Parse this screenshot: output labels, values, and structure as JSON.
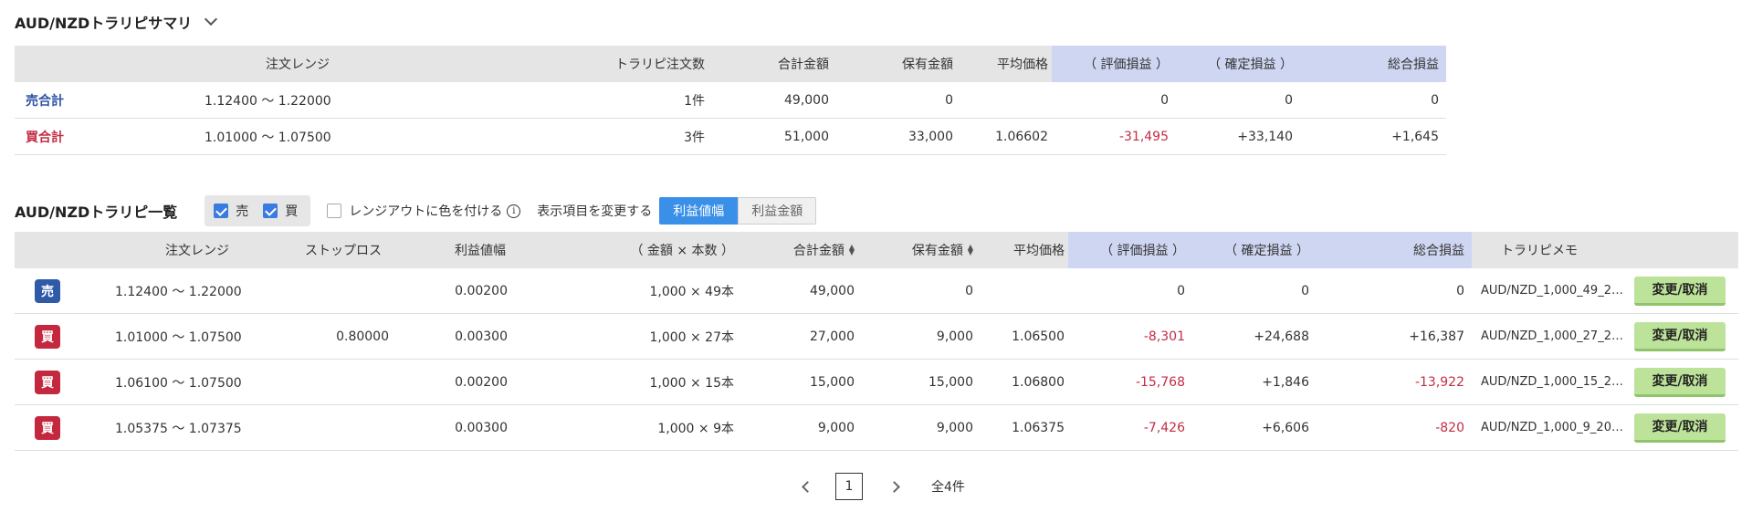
{
  "summary": {
    "title": "AUD/NZDトラリピサマリ",
    "headers": {
      "range": "注文レンジ",
      "orders": "トラリピ注文数",
      "total": "合計金額",
      "holding": "保有金額",
      "avg": "平均価格",
      "unrealized": "（ 評価損益 ）",
      "realized": "（ 確定損益 ）",
      "net": "総合損益"
    },
    "rows": [
      {
        "label": "売合計",
        "range": "1.12400 〜 1.22000",
        "orders": "1件",
        "total": "49,000",
        "holding": "0",
        "avg": "",
        "unrealized": "0",
        "realized": "0",
        "net": "0"
      },
      {
        "label": "買合計",
        "range": "1.01000 〜 1.07500",
        "orders": "3件",
        "total": "51,000",
        "holding": "33,000",
        "avg": "1.06602",
        "unrealized": "-31,495",
        "realized": "+33,140",
        "net": "+1,645"
      }
    ]
  },
  "list": {
    "title": "AUD/NZDトラリピ一覧",
    "filters": {
      "sell": "売",
      "buy": "買",
      "color_out": "レンジアウトに色を付ける",
      "info_icon": "i"
    },
    "display_label": "表示項目を変更する",
    "seg": {
      "active": "利益値幅",
      "inactive": "利益金額"
    },
    "headers": {
      "range": "注文レンジ",
      "stop": "ストップロス",
      "width": "利益値幅",
      "amount": "（ 金額 × 本数 ）",
      "total": "合計金額",
      "holding": "保有金額",
      "avg": "平均価格",
      "unrealized": "（ 評価損益 ）",
      "realized": "（ 確定損益 ）",
      "net": "総合損益",
      "memo": "トラリピメモ"
    },
    "button_label": "変更/取消",
    "rows": [
      {
        "side": "売",
        "range": "1.12400 〜 1.22000",
        "stop": "",
        "width": "0.00200",
        "amount": "1,000 × 49本",
        "total": "49,000",
        "holding": "0",
        "avg": "",
        "unrealized": "0",
        "realized": "0",
        "net": "0",
        "memo": "AUD/NZD_1,000_49_2…"
      },
      {
        "side": "買",
        "range": "1.01000 〜 1.07500",
        "stop": "0.80000",
        "width": "0.00300",
        "amount": "1,000 × 27本",
        "total": "27,000",
        "holding": "9,000",
        "avg": "1.06500",
        "unrealized": "-8,301",
        "realized": "+24,688",
        "net": "+16,387",
        "memo": "AUD/NZD_1,000_27_2…"
      },
      {
        "side": "買",
        "range": "1.06100 〜 1.07500",
        "stop": "",
        "width": "0.00200",
        "amount": "1,000 × 15本",
        "total": "15,000",
        "holding": "15,000",
        "avg": "1.06800",
        "unrealized": "-15,768",
        "realized": "+1,846",
        "net": "-13,922",
        "memo": "AUD/NZD_1,000_15_2…"
      },
      {
        "side": "買",
        "range": "1.05375 〜 1.07375",
        "stop": "",
        "width": "0.00300",
        "amount": "1,000 × 9本",
        "total": "9,000",
        "holding": "9,000",
        "avg": "1.06375",
        "unrealized": "-7,426",
        "realized": "+6,606",
        "net": "-820",
        "memo": "AUD/NZD_1,000_9_20…"
      }
    ]
  },
  "pagination": {
    "current": "1",
    "total_label": "全4件"
  }
}
